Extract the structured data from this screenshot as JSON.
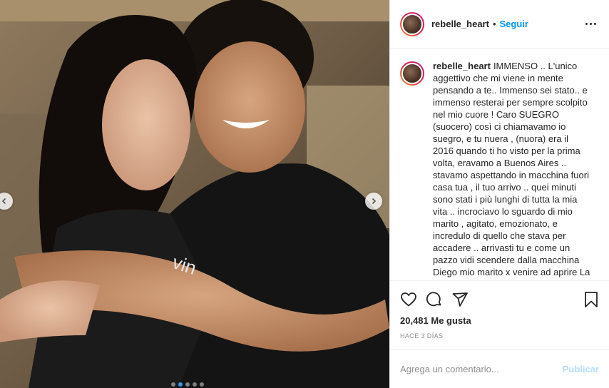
{
  "post": {
    "username": "rebelle_heart",
    "separator": "•",
    "follow_label": "Seguir",
    "more_icon": "more-horizontal-icon",
    "caption": {
      "username": "rebelle_heart",
      "text": "IMMENSO .. L'unico aggettivo che mi viene in mente pensando a te.. Immenso sei stato.. e immenso resterai per sempre scolpito nel mio cuore ! Caro SUEGRO (suocero) così ci chiamavamo io suegro, e tu nuera , (nuora) era il 2016 quando ti ho visto per la prima volta, eravamo a Buenos Aires .. stavamo aspettando in macchina fuori casa tua , il tuo arrivo .. quei minuti sono stati i più lunghi di tutta la mia vita .. incrociavo lo sguardo di mio marito , agitato, emozionato, e incredulo di quello che stava per accadere .. arrivasti tu e come un pazzo vidi scendere dalla macchina Diego mio marito x venire ad aprire La portiera della tua auto, io rimasi seduta e dal finestrino vidi la scena che x tanto"
    },
    "likes_count": "20,481",
    "likes_label": "Me gusta",
    "timestamp": "HACE 3 DÍAS",
    "comment_placeholder": "Agrega un comentario...",
    "publish_label": "Publicar",
    "icons": {
      "like": "heart-icon",
      "comment": "comment-icon",
      "share": "share-icon",
      "save": "bookmark-icon",
      "prev": "chevron-left-icon",
      "next": "chevron-right-icon"
    },
    "carousel": {
      "total": 5,
      "active": 1
    },
    "colors": {
      "accent": "#0095f6",
      "publish": "#b2dffc",
      "muted": "#8e8e8e"
    }
  }
}
